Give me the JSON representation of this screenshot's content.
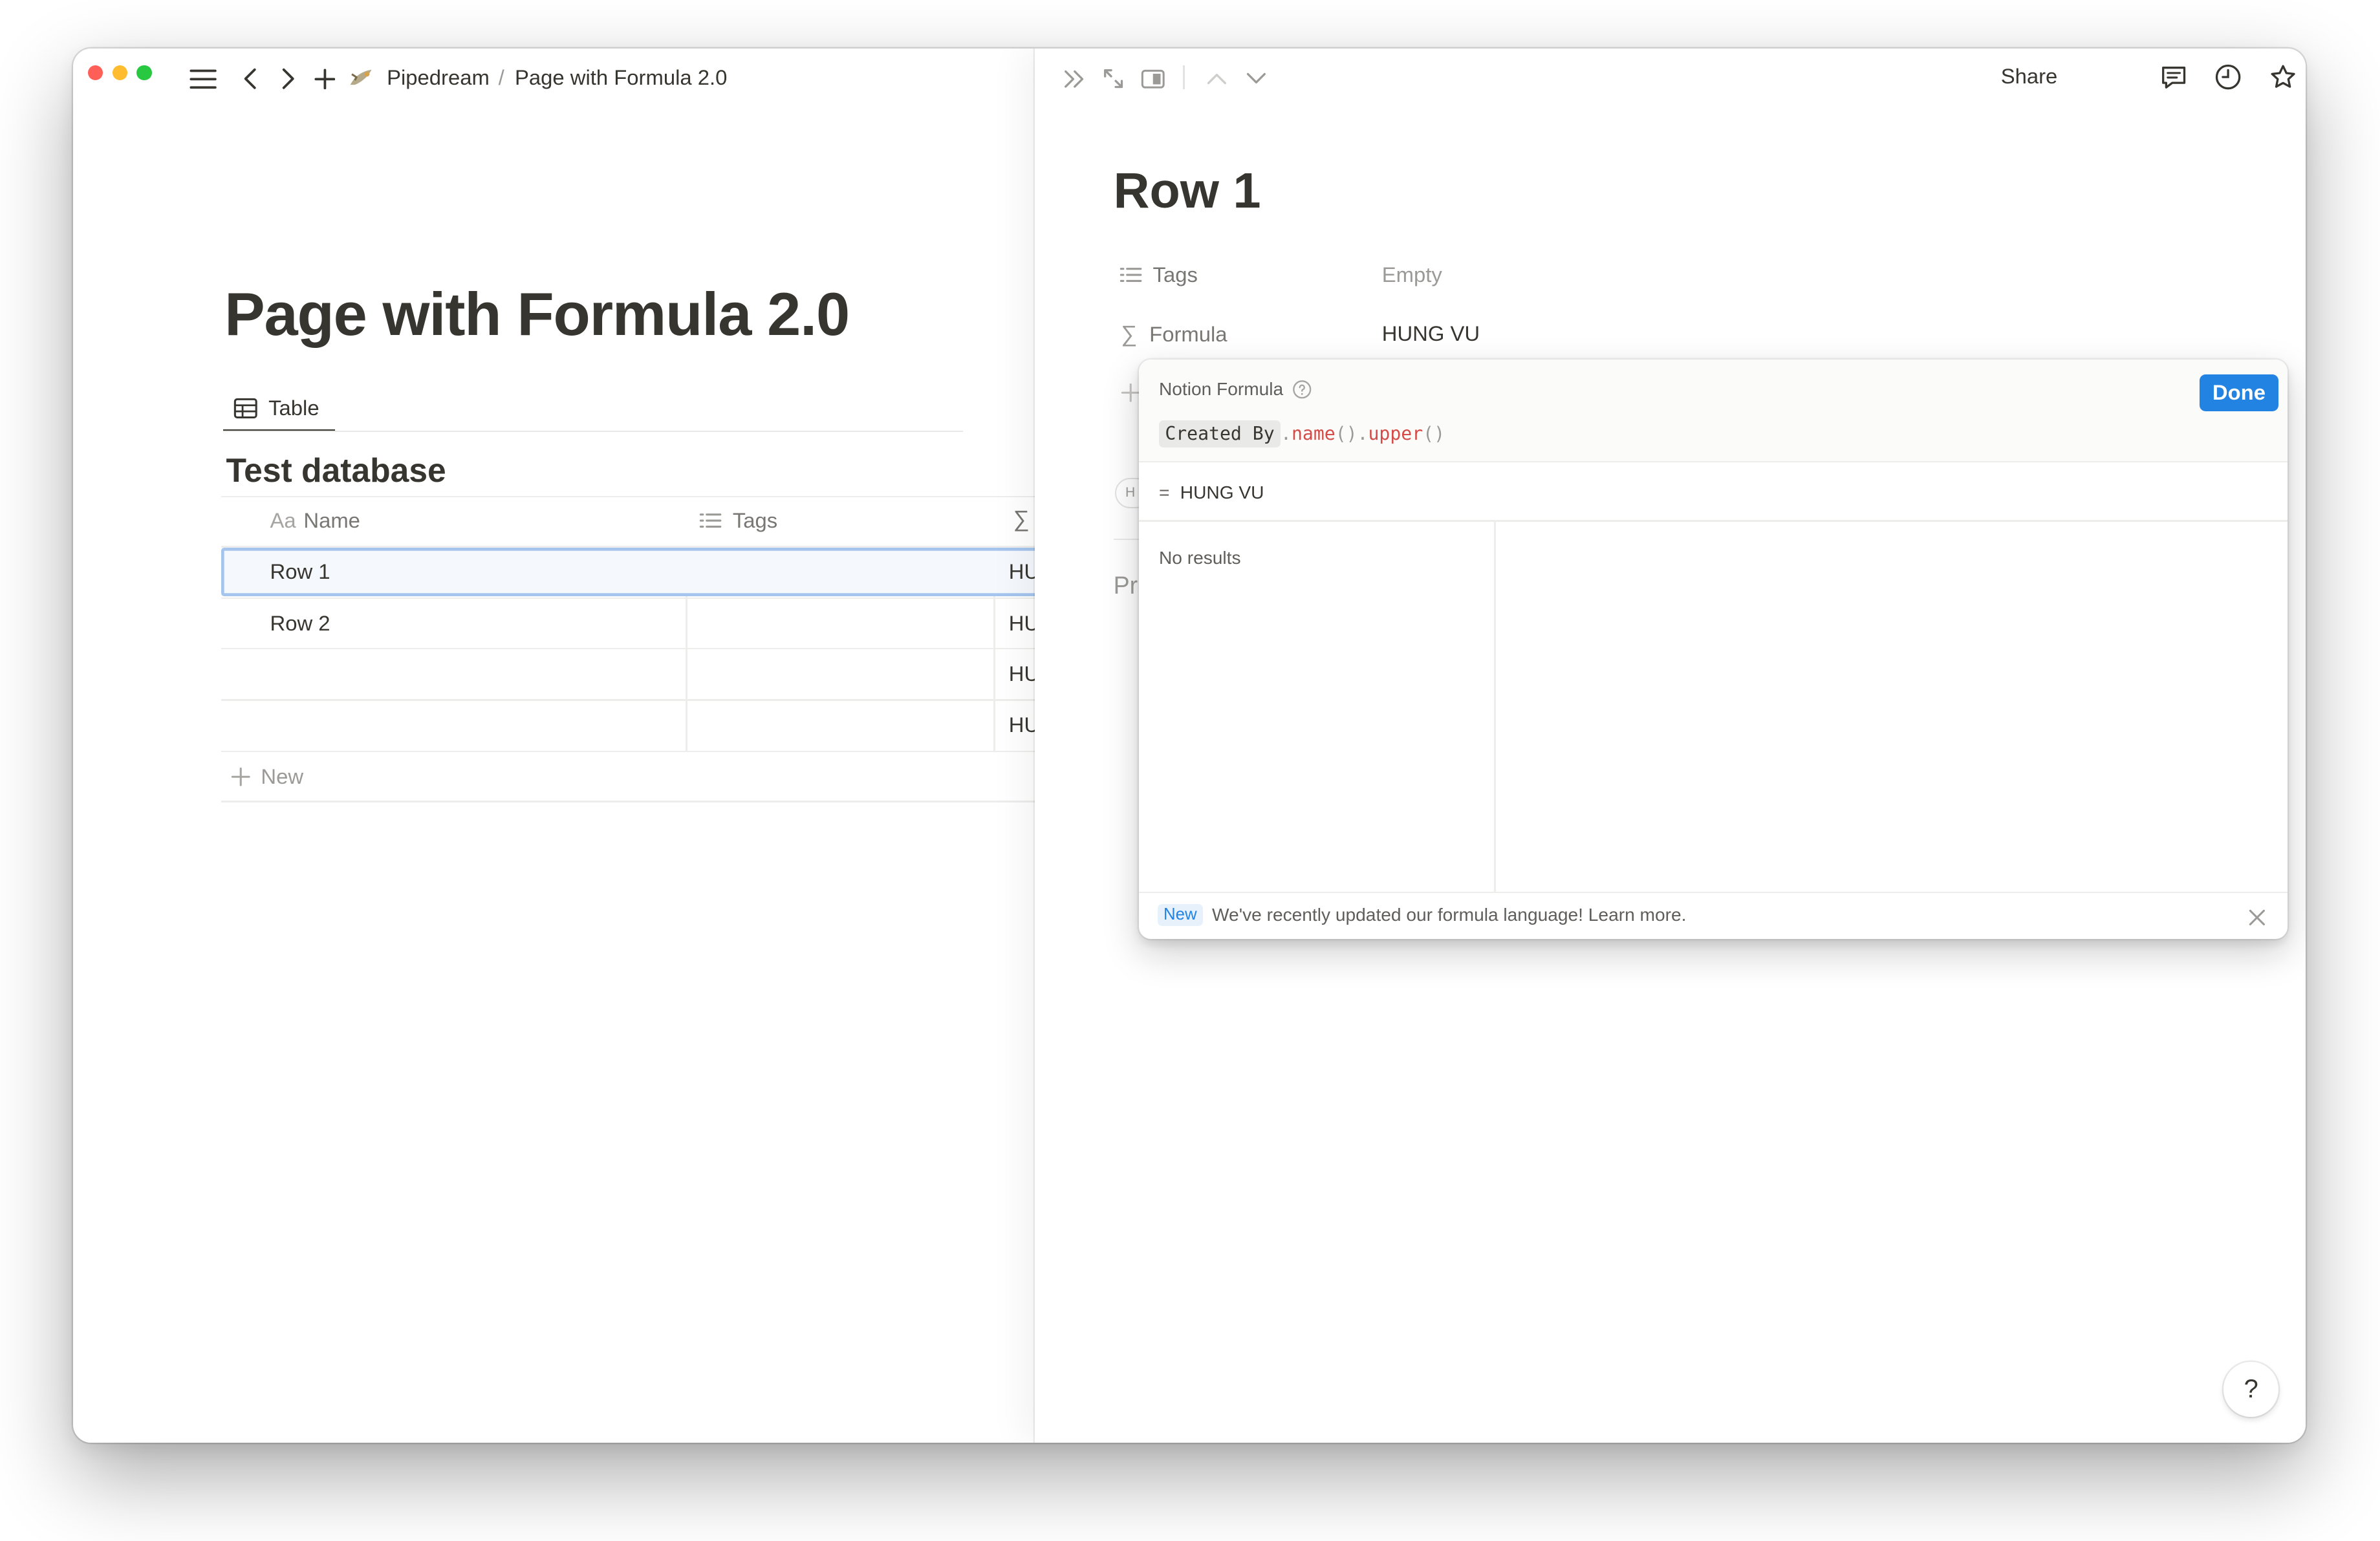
{
  "breadcrumb": {
    "workspace": "Pipedream",
    "separator": "/",
    "page": "Page with Formula 2.0"
  },
  "topbar": {
    "share_label": "Share"
  },
  "page": {
    "title": "Page with Formula 2.0",
    "view_tab": "Table",
    "database_title": "Test database"
  },
  "table": {
    "columns": [
      {
        "icon": "Aa",
        "label": "Name"
      },
      {
        "label": "Tags"
      }
    ],
    "rows": [
      {
        "name": "Row 1",
        "formula": "HU"
      },
      {
        "name": "Row 2",
        "formula": "HU"
      },
      {
        "name": "",
        "formula": "HU"
      },
      {
        "name": "",
        "formula": "HU"
      }
    ],
    "new_label": "New"
  },
  "row_page": {
    "title": "Row 1",
    "properties": [
      {
        "label": "Tags",
        "value": "Empty"
      },
      {
        "label": "Formula",
        "value": "HUNG VU"
      }
    ],
    "hidden_letter": "H",
    "hidden_text": "Pr"
  },
  "formula_popup": {
    "title": "Notion Formula",
    "done_label": "Done",
    "expression": {
      "token": "Created By",
      "p1": ".",
      "f1": "name",
      "p2": "().",
      "f2": "upper",
      "p3": "()"
    },
    "result_prefix": "=",
    "result": "HUNG VU",
    "no_results": "No results",
    "footer_badge": "New",
    "footer_text": "We've recently updated our formula language! Learn more."
  },
  "help_label": "?",
  "colors": {
    "accent": "#2383e2",
    "text": "#37352f",
    "muted": "#787774",
    "code_function": "#d44c47",
    "selection": "#eaf1fb"
  }
}
